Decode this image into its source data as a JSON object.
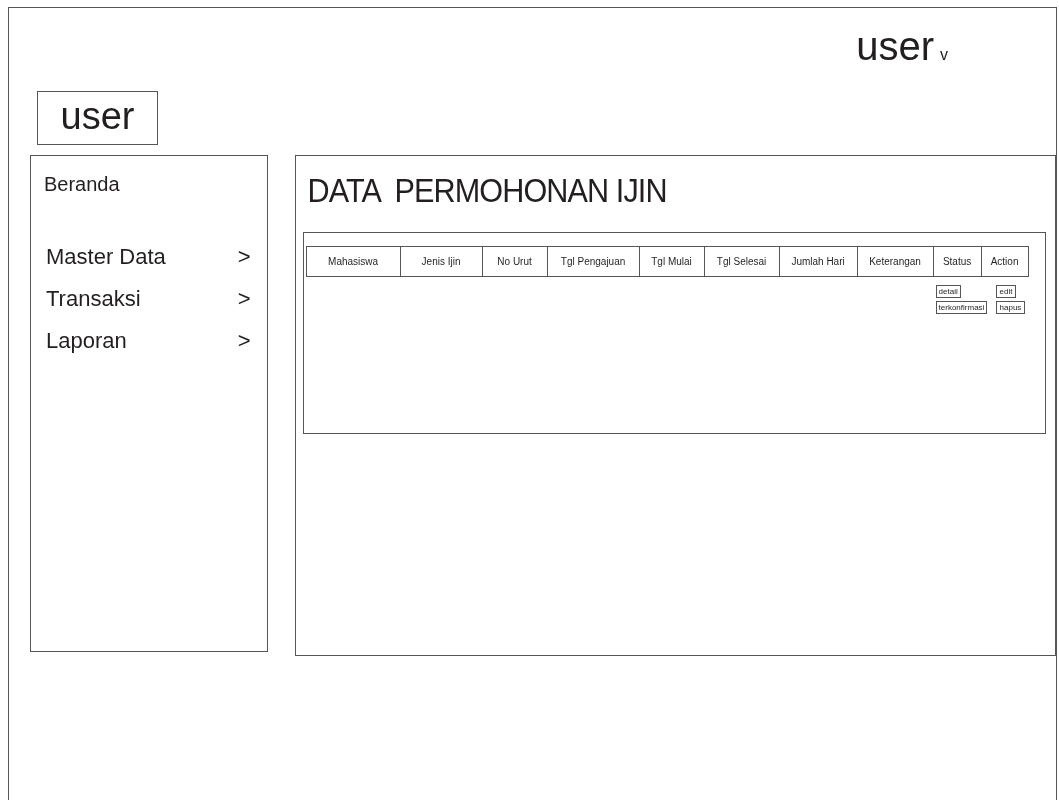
{
  "user_menu": {
    "label": "user",
    "caret": "v"
  },
  "logo": "user",
  "sidebar": {
    "items": [
      {
        "label": "Beranda"
      },
      {
        "label": "Master Data",
        "arrow": ">"
      },
      {
        "label": "Transaksi",
        "arrow": ">"
      },
      {
        "label": "Laporan",
        "arrow": ">"
      }
    ]
  },
  "page_title": "DATA  PERMOHONAN IJIN",
  "table": {
    "columns": [
      "Mahasiswa",
      "Jenis Ijin",
      "No Urut",
      "Tgl Pengajuan",
      "Tgl Mulai",
      "Tgl Selesai",
      "Jumlah Hari",
      "Keterangan",
      "Status",
      "Action"
    ],
    "rows": [
      {
        "status_buttons": [
          "detail",
          "terkonfirmasi"
        ],
        "action_buttons": [
          "edit",
          "hapus"
        ]
      }
    ]
  }
}
